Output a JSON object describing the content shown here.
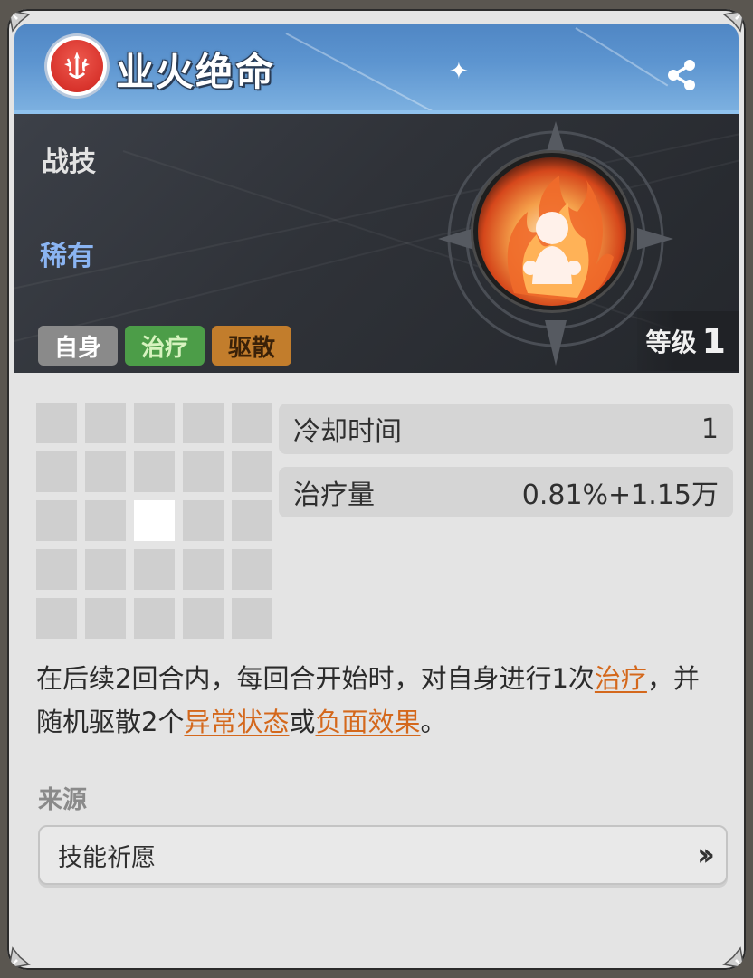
{
  "header": {
    "title": "业火绝命"
  },
  "banner": {
    "skill_type": "战技",
    "rarity": "稀有",
    "tags": [
      "自身",
      "治疗",
      "驱散"
    ],
    "level_label": "等级",
    "level_value": "1"
  },
  "stats": [
    {
      "label": "冷却时间",
      "value": "1"
    },
    {
      "label": "治疗量",
      "value": "0.81%+1.15万"
    }
  ],
  "range_grid": {
    "rows": 5,
    "cols": 5,
    "active_cell": [
      2,
      2
    ]
  },
  "description": {
    "part1": "在后续2回合内，每回合开始时，对自身进行1次",
    "kw_heal": "治疗",
    "part2": "，并随机驱散2个",
    "kw_abnormal": "异常状态",
    "part3": "或",
    "kw_negative": "负面效果",
    "part4": "。"
  },
  "source": {
    "label": "来源",
    "button": "技能祈愿"
  },
  "icons": [
    "share-icon",
    "emblem-icon",
    "skill-fire-icon",
    "double-chevron-right-icon"
  ],
  "colors": {
    "header": "#5d95d0",
    "rarity": "#8ab4f2",
    "keyword": "#d4681c",
    "heal_tag": "#4c9d48",
    "dispel_tag": "#c27d2c"
  }
}
